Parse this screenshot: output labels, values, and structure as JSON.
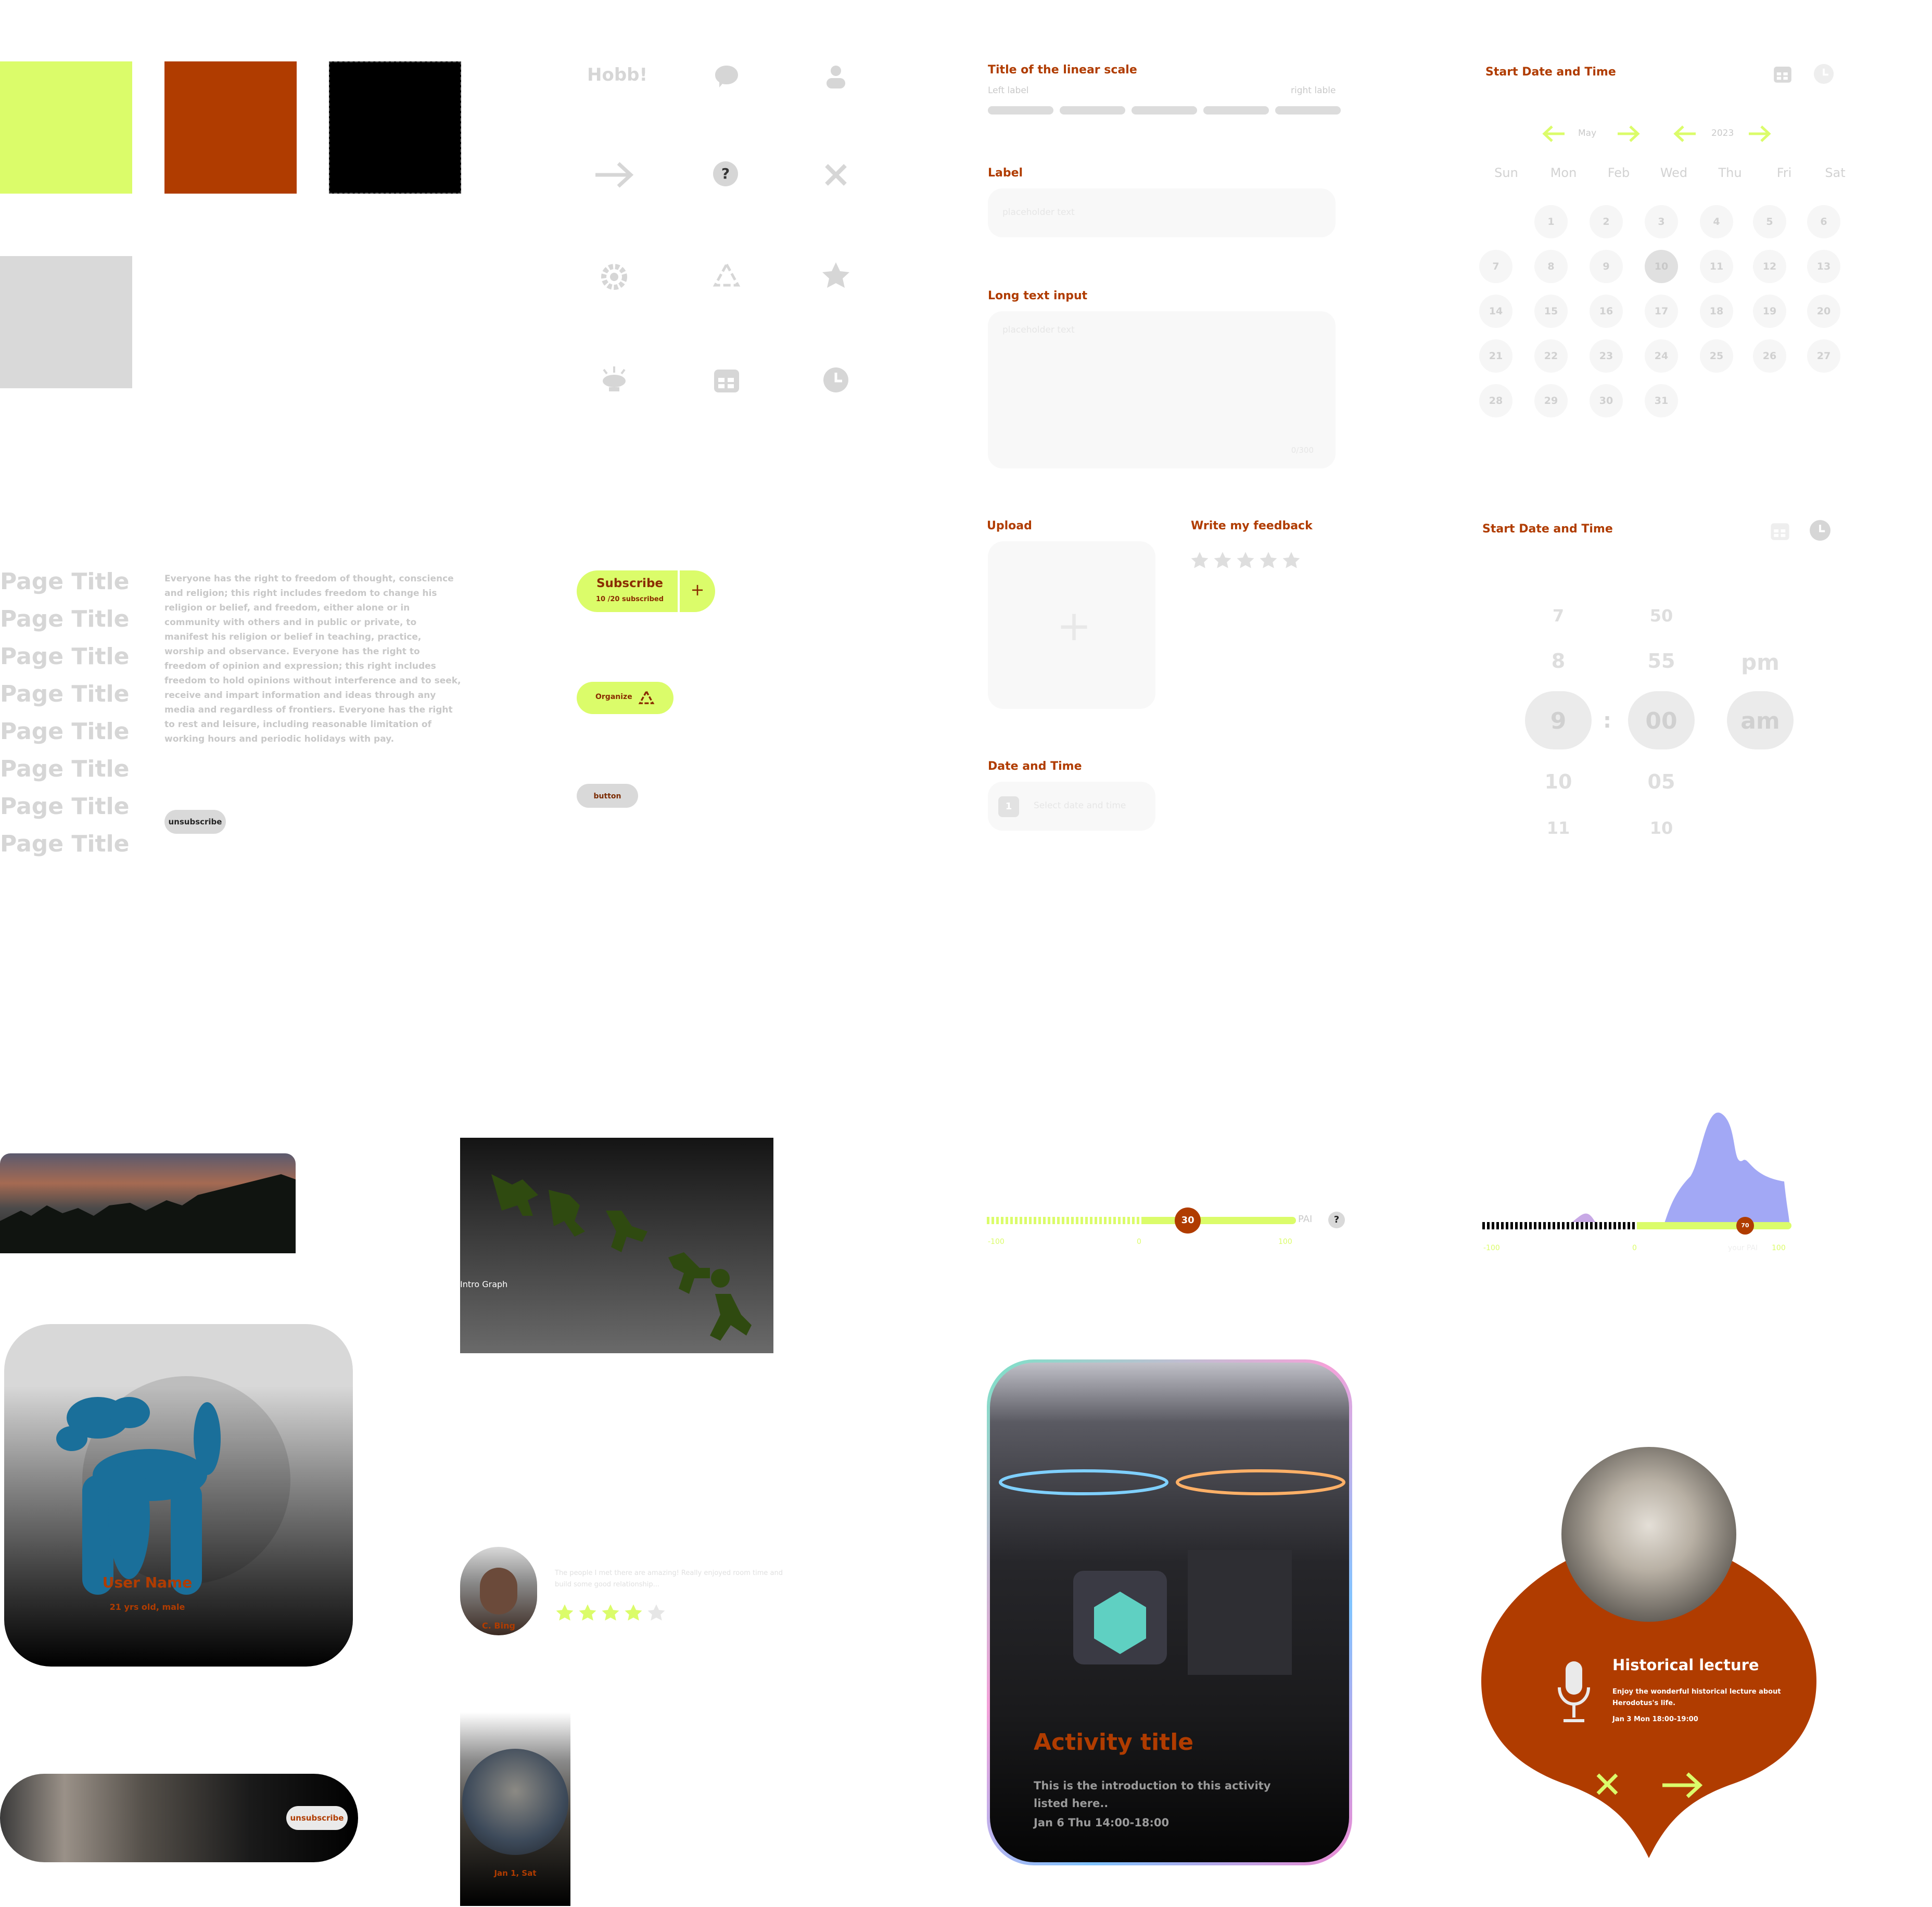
{
  "colors": {
    "lime": "#dbfc6a",
    "rust": "#b03c00",
    "black": "#000000",
    "grey": "#d9d9d9",
    "lilac": "#a2a8f5"
  },
  "icons": {
    "logo_text": "Hobb!",
    "set": [
      "chat-bubble-icon",
      "user-icon",
      "arrow-right-icon",
      "help-icon",
      "close-icon",
      "gear-icon",
      "recycle-icon",
      "star-icon",
      "lamp-icon",
      "calendar-icon",
      "clock-icon"
    ],
    "help_glyph": "?"
  },
  "linear_scale": {
    "title": "Title of the linear scale",
    "left": "Left label",
    "right": "right lable"
  },
  "label_field": {
    "label": "Label",
    "placeholder": "placeholder text"
  },
  "long_text": {
    "label": "Long text input",
    "placeholder": "placeholder text",
    "counter": "0/300"
  },
  "upload": {
    "label": "Upload",
    "plus": "+"
  },
  "feedback": {
    "label": "Write my feedback"
  },
  "date_time": {
    "label": "Date and Time",
    "placeholder": "Select date and time",
    "icon_digit": "1"
  },
  "calendar": {
    "title": "Start Date and Time",
    "month": "May",
    "year": "2023",
    "days_of_week": [
      "Sun",
      "Mon",
      "Feb",
      "Wed",
      "Thu",
      "Fri",
      "Sat"
    ],
    "dates": [
      "1",
      "2",
      "3",
      "4",
      "5",
      "6",
      "7",
      "8",
      "9",
      "10",
      "11",
      "12",
      "13",
      "14",
      "15",
      "16",
      "17",
      "18",
      "19",
      "20",
      "21",
      "22",
      "23",
      "24",
      "25",
      "26",
      "27",
      "28",
      "29",
      "30",
      "31"
    ],
    "selected": "10"
  },
  "time_picker": {
    "title": "Start Date and Time",
    "hours": [
      "7",
      "8",
      "9",
      "10",
      "11"
    ],
    "minutes": [
      "50",
      "55",
      "00",
      "05",
      "10"
    ],
    "ampm": [
      "pm",
      "am"
    ],
    "separator": ":"
  },
  "page_titles": [
    "Page Title",
    "Page Title",
    "Page Title",
    "Page Title",
    "Page Title",
    "Page Title",
    "Page Title",
    "Page Title"
  ],
  "body_text": "Everyone has the right to freedom of thought, conscience and religion; this right includes freedom to change his religion or belief, and freedom, either alone or in community with others and in public or private, to manifest his religion or belief in teaching, practice, worship and observance. Everyone has the right to freedom of opinion and expression; this right includes freedom to hold opinions without interference and to seek, receive and impart information and ideas through any media and regardless of frontiers. Everyone has the right to rest and leisure, including reasonable limitation of working hours and periodic holidays with pay.",
  "buttons": {
    "unsubscribe": "unsubscribe",
    "subscribe": "Subscribe",
    "subscribe_count": "10 /20 subscribed",
    "plus": "+",
    "organize": "Organize",
    "generic": "button"
  },
  "slider_pai": {
    "value": "30",
    "min": "-100",
    "mid": "0",
    "max": "100",
    "unit": "PAI",
    "help": "?",
    "value_fraction": 0.65
  },
  "slider_graph": {
    "value": "70",
    "min": "-100",
    "mid": "0",
    "max": "100",
    "your_pai": "your PAI",
    "value_fraction": 0.85
  },
  "intro_graph": {
    "label": "Intro Graph"
  },
  "user_card": {
    "name": "User Name",
    "meta": "21 yrs old, male"
  },
  "review": {
    "name": "C. Bing",
    "text": "The people I met there are amazing! Really enjoyed room time and build some good relationship...",
    "rating": 4
  },
  "date_card": {
    "date": "Jan 1, Sat"
  },
  "banner": {
    "unsubscribe": "unsubscribe"
  },
  "activity": {
    "title": "Activity title",
    "desc": "This is the introduction to this activity listed here..",
    "when": "Jan 6 Thu 14:00-18:00"
  },
  "lecture": {
    "title": "Historical lecture",
    "desc": "Enjoy the wonderful historical lecture about Herodotus's life.",
    "when": "Jan 3 Mon 18:00-19:00"
  }
}
